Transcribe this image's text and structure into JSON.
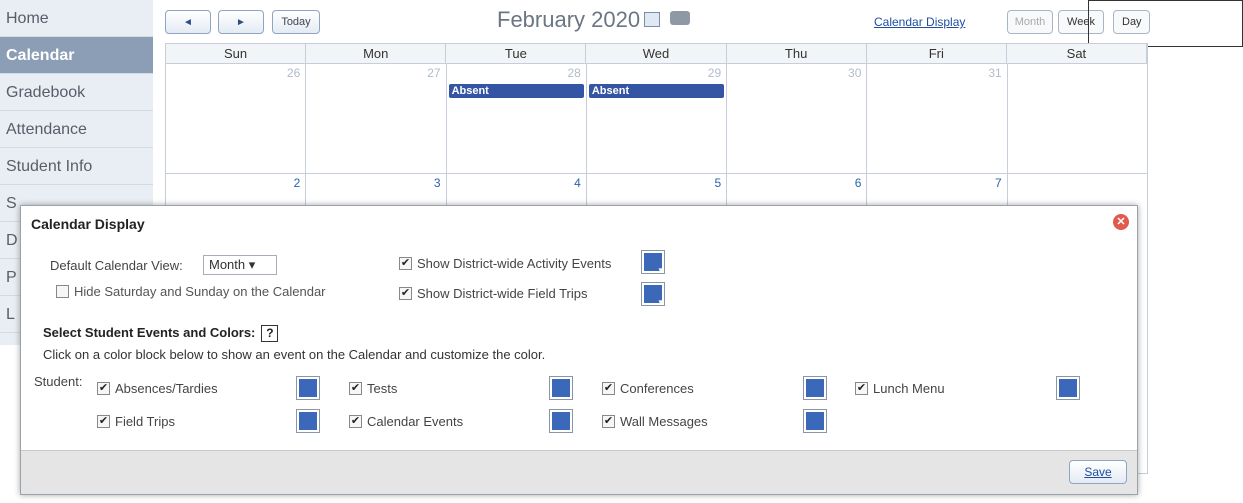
{
  "sidebar": {
    "items": [
      {
        "label": "Home"
      },
      {
        "label": "Calendar"
      },
      {
        "label": "Gradebook"
      },
      {
        "label": "Attendance"
      },
      {
        "label": "Student Info"
      },
      {
        "label": "S"
      },
      {
        "label": "D"
      },
      {
        "label": "P"
      },
      {
        "label": "L"
      }
    ]
  },
  "toolbar": {
    "prev_icon": "◄",
    "next_icon": "►",
    "today_label": "Today",
    "title": "February 2020",
    "calendar_display_link": "Calendar Display",
    "month_label": "Month",
    "week_label": "Week",
    "day_label": "Day"
  },
  "calendar": {
    "weekdays": [
      "Sun",
      "Mon",
      "Tue",
      "Wed",
      "Thu",
      "Fri",
      "Sat"
    ],
    "week1": [
      "26",
      "27",
      "28",
      "29",
      "30",
      "31",
      ""
    ],
    "week2": [
      "2",
      "3",
      "4",
      "5",
      "6",
      "7",
      ""
    ],
    "event_label": "Absent"
  },
  "dialog": {
    "title": "Calendar Display",
    "close_icon": "✕",
    "default_view_label": "Default Calendar View:",
    "default_view_value": "Month ▾",
    "hide_weekend_label": "Hide Saturday and Sunday on the Calendar",
    "district_activity_label": "Show District-wide Activity Events",
    "district_field_trips_label": "Show District-wide Field Trips",
    "select_events_label": "Select Student Events and Colors:",
    "help_icon": "?",
    "instructions": "Click on a color block below to show an event on the Calendar and customize the color.",
    "student_label": "Student:",
    "events": [
      {
        "label": "Absences/Tardies"
      },
      {
        "label": "Tests"
      },
      {
        "label": "Conferences"
      },
      {
        "label": "Lunch Menu"
      },
      {
        "label": "Field Trips"
      },
      {
        "label": "Calendar Events"
      },
      {
        "label": "Wall Messages"
      }
    ],
    "save_label": "Save",
    "check_mark": "✔"
  },
  "colors": {
    "accent": "#3b68b8",
    "event_bar": "#3454a4",
    "sidebar_active": "#8b9eb5"
  }
}
